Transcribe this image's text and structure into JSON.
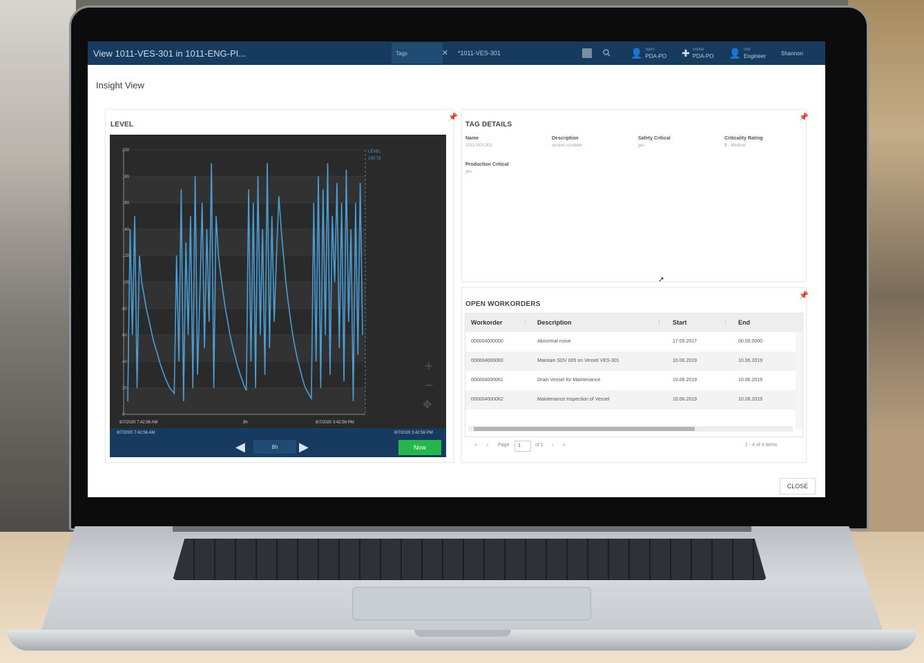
{
  "window": {
    "title": "View 1011-VES-301 in 1011-ENG-PI...",
    "search_tag_label": "Tags",
    "search_value": "*1011-VES-301"
  },
  "header_actions": [
    {
      "small": "open",
      "label": "PDA-PO"
    },
    {
      "small": "create",
      "label": "PDA-PO"
    },
    {
      "small": "role",
      "label": "Engineer"
    }
  ],
  "user": "Shannon",
  "page_title": "Insight View",
  "level_panel": {
    "title": "LEVEL",
    "legend": [
      "LEVEL",
      "100.73"
    ],
    "x_tick_start": "8/7/2020 7:42:56 AM",
    "x_tick_mid": "8h",
    "x_tick_end": "8/7/2020 3:42:56 PM",
    "footer_start": "8/7/2020 7:42:56 AM",
    "footer_end": "8/7/2020 3:42:56 PM",
    "range": "8h",
    "now_label": "Now"
  },
  "chart_data": {
    "type": "line",
    "title": "LEVEL",
    "xlabel": "",
    "ylabel": "",
    "ylim": [
      0,
      200
    ],
    "yticks": [
      "200",
      "180",
      "160",
      "140",
      "120",
      "100",
      "80",
      "60",
      "40",
      "20",
      "0"
    ],
    "x_range": [
      "8/7/2020 7:42:56 AM",
      "8/7/2020 3:42:56 PM"
    ],
    "series": [
      {
        "name": "LEVEL",
        "values": [
          10,
          140,
          60,
          150,
          20,
          120,
          100,
          90,
          80,
          72,
          64,
          56,
          50,
          44,
          38,
          33,
          28,
          24,
          20,
          18,
          16,
          120,
          40,
          170,
          10,
          130,
          60,
          150,
          20,
          180,
          30,
          90,
          160,
          50,
          140,
          70,
          190,
          20,
          150,
          120,
          105,
          92,
          80,
          70,
          60,
          52,
          45,
          38,
          32,
          27,
          22,
          18,
          170,
          40,
          160,
          20,
          180,
          60,
          140,
          30,
          190,
          50,
          150,
          70,
          120,
          165,
          140,
          120,
          100,
          85,
          72,
          60,
          50,
          42,
          35,
          28,
          22,
          18,
          15,
          12,
          160,
          40,
          180,
          20,
          170,
          60,
          190,
          30,
          150,
          100,
          175,
          50,
          160,
          25,
          185,
          70,
          140,
          10,
          160,
          45,
          175,
          60
        ]
      }
    ],
    "grid": true,
    "background": "#2a2a2b",
    "line_color": "#4a9ed6"
  },
  "tag_details": {
    "title": "TAG DETAILS",
    "fields": [
      {
        "label": "Name",
        "value": "1011-VES-301"
      },
      {
        "label": "Description",
        "value": "suction scrubber"
      },
      {
        "label": "Safety Critical",
        "value": "yes"
      },
      {
        "label": "Criticality Rating",
        "value": "B - Medium"
      },
      {
        "label": "Production Critical",
        "value": "yes"
      }
    ]
  },
  "workorders": {
    "title": "OPEN WORKORDERS",
    "columns": [
      "Workorder",
      "Description",
      "Start",
      "End"
    ],
    "rows": [
      [
        "000004000000",
        "Abnormal noise",
        "17.05.2017",
        "00.00.0000"
      ],
      [
        "000004000060",
        "Maintain SDV 005 on Vessel VES-301",
        "10.06.2019",
        "10.06.2019"
      ],
      [
        "000004000061",
        "Drain Vessel for Maintenance",
        "10.06.2019",
        "10.06.2019"
      ],
      [
        "000004000062",
        "Maintenance Inspection of Vessel",
        "10.06.2019",
        "10.06.2019"
      ]
    ],
    "pager": {
      "page_label": "Page",
      "page_value": "1",
      "of_label": "of 1",
      "summary": "1 - 4 of 4 items"
    }
  },
  "close_label": "CLOSE",
  "colors": {
    "titlebar": "#163b5e",
    "accent_green": "#27b64c",
    "chart_line": "#4a9ed6"
  }
}
